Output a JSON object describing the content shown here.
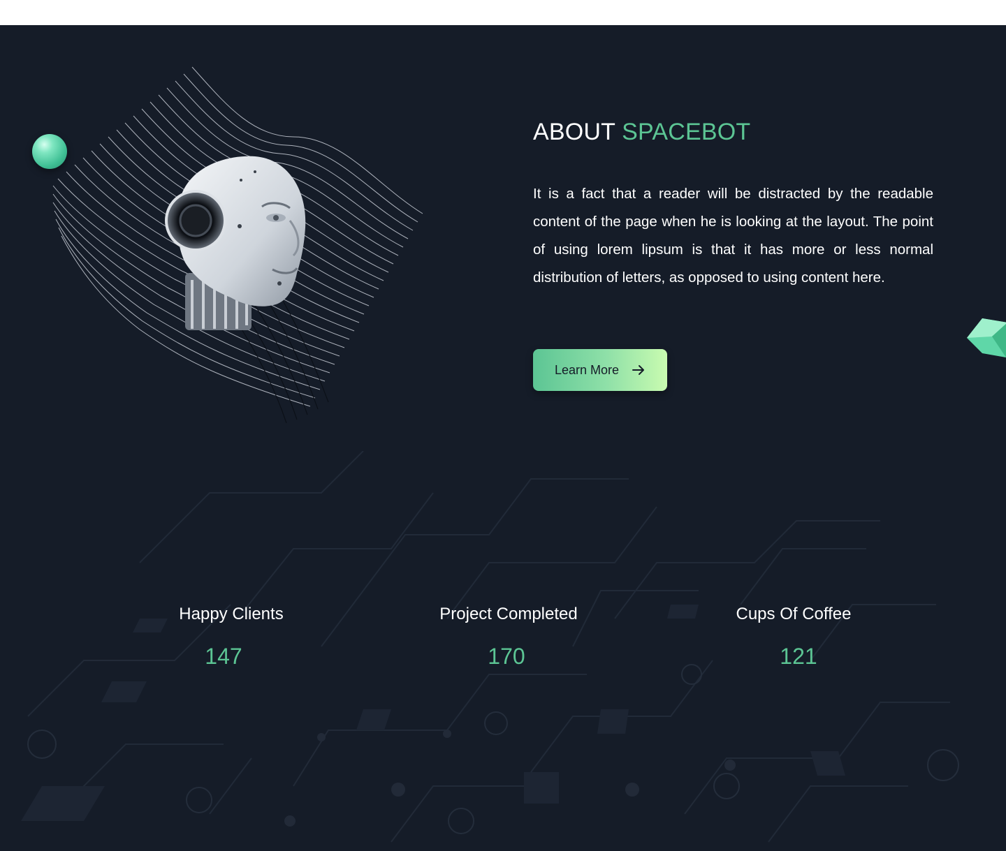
{
  "about": {
    "title_prefix": "ABOUT",
    "title_accent": "SPACEBOT",
    "body": "It is a fact that a reader will be distracted by the readable content of the page when he is looking at the layout. The point of using lorem lipsum is that it has more or less normal distribution of letters, as opposed to using content here.",
    "button_label": "Learn More",
    "button_icon": "arrow-right-icon"
  },
  "stats": [
    {
      "label": "Happy Clients",
      "value": "147"
    },
    {
      "label": "Project Completed",
      "value": "170"
    },
    {
      "label": "Cups Of Coffee",
      "value": "121"
    }
  ],
  "colors": {
    "background": "#151c28",
    "accent": "#5cc594",
    "button_gradient_start": "#5cc594",
    "button_gradient_end": "#c9fbb0",
    "text": "#ffffff"
  }
}
